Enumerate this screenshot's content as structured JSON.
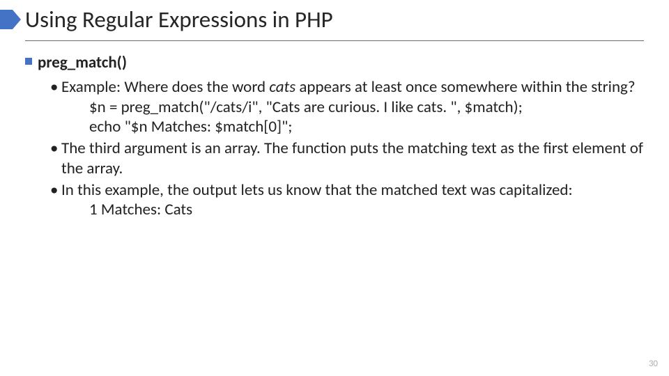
{
  "title": "Using Regular Expressions in PHP",
  "section": "preg_match()",
  "b1a": "Example: Where does the word ",
  "b1italic": "cats",
  "b1b": " appears at least once somewhere within the string?",
  "code1": "$n = preg_match(\"/cats/i\", \"Cats are curious. I like cats. \", $match);",
  "code2": "echo \"$n Matches: $match[0]\";",
  "b2": "The third argument is an array. The function puts the matching text as the first element of the array.",
  "b3": "In this example, the output lets us know that the matched text was capitalized:",
  "out": "1 Matches: Cats",
  "page": "30"
}
